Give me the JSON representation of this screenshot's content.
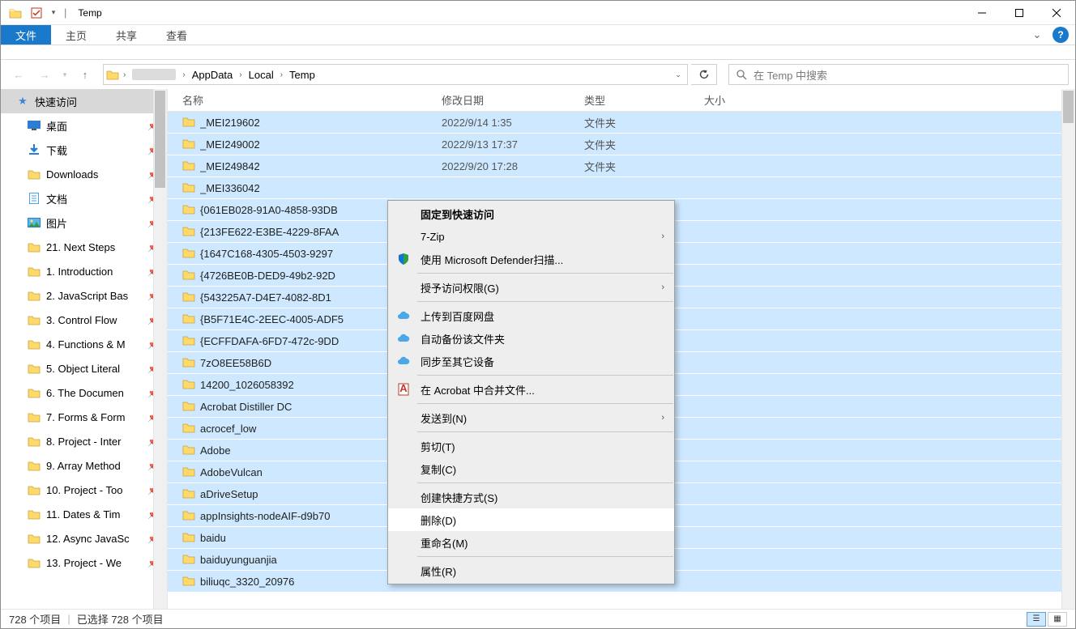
{
  "window": {
    "title": "Temp"
  },
  "ribbon": {
    "file": "文件",
    "home": "主页",
    "share": "共享",
    "view": "查看"
  },
  "address": {
    "segs": [
      "AppData",
      "Local",
      "Temp"
    ]
  },
  "search": {
    "placeholder": "在 Temp 中搜索"
  },
  "sidebar": {
    "quick": "快速访问",
    "items": [
      {
        "label": "桌面",
        "icon": "desktop"
      },
      {
        "label": "下载",
        "icon": "download"
      },
      {
        "label": "Downloads",
        "icon": "folder"
      },
      {
        "label": "文档",
        "icon": "document"
      },
      {
        "label": "图片",
        "icon": "picture"
      },
      {
        "label": "21. Next Steps",
        "icon": "folder"
      },
      {
        "label": "1. Introduction",
        "icon": "folder"
      },
      {
        "label": "2. JavaScript Bas",
        "icon": "folder"
      },
      {
        "label": "3. Control Flow",
        "icon": "folder"
      },
      {
        "label": "4. Functions & M",
        "icon": "folder"
      },
      {
        "label": "5. Object Literal",
        "icon": "folder"
      },
      {
        "label": "6. The Documen",
        "icon": "folder"
      },
      {
        "label": "7. Forms & Form",
        "icon": "folder"
      },
      {
        "label": "8. Project - Inter",
        "icon": "folder"
      },
      {
        "label": "9. Array Method",
        "icon": "folder"
      },
      {
        "label": "10. Project - Too",
        "icon": "folder"
      },
      {
        "label": "11. Dates & Tim",
        "icon": "folder"
      },
      {
        "label": "12. Async JavaSc",
        "icon": "folder"
      },
      {
        "label": "13. Project - We",
        "icon": "folder"
      }
    ]
  },
  "columns": {
    "name": "名称",
    "date": "修改日期",
    "type": "类型",
    "size": "大小"
  },
  "files": [
    {
      "name": "_MEI219602",
      "date": "2022/9/14 1:35",
      "type": "文件夹"
    },
    {
      "name": "_MEI249002",
      "date": "2022/9/13 17:37",
      "type": "文件夹"
    },
    {
      "name": "_MEI249842",
      "date": "2022/9/20 17:28",
      "type": "文件夹"
    },
    {
      "name": "_MEI336042",
      "date": "",
      "type": ""
    },
    {
      "name": "{061EB028-91A0-4858-93DB",
      "date": "",
      "type": ""
    },
    {
      "name": "{213FE622-E3BE-4229-8FAA",
      "date": "",
      "type": ""
    },
    {
      "name": "{1647C168-4305-4503-9297",
      "date": "",
      "type": ""
    },
    {
      "name": "{4726BE0B-DED9-49b2-92D",
      "date": "",
      "type": ""
    },
    {
      "name": "{543225A7-D4E7-4082-8D1",
      "date": "",
      "type": ""
    },
    {
      "name": "{B5F71E4C-2EEC-4005-ADF5",
      "date": "",
      "type": ""
    },
    {
      "name": "{ECFFDAFA-6FD7-472c-9DD",
      "date": "",
      "type": ""
    },
    {
      "name": "7zO8EE58B6D",
      "date": "",
      "type": ""
    },
    {
      "name": "14200_1026058392",
      "date": "",
      "type": ""
    },
    {
      "name": "Acrobat Distiller DC",
      "date": "",
      "type": ""
    },
    {
      "name": "acrocef_low",
      "date": "",
      "type": ""
    },
    {
      "name": "Adobe",
      "date": "",
      "type": ""
    },
    {
      "name": "AdobeVulcan",
      "date": "",
      "type": ""
    },
    {
      "name": "aDriveSetup",
      "date": "",
      "type": ""
    },
    {
      "name": "appInsights-nodeAIF-d9b70",
      "date": "",
      "type": ""
    },
    {
      "name": "baidu",
      "date": "",
      "type": ""
    },
    {
      "name": "baiduyunguanjia",
      "date": "",
      "type": ""
    },
    {
      "name": "biliuqc_3320_20976",
      "date": "",
      "type": ""
    }
  ],
  "context": {
    "pin": "固定到快速访问",
    "sevenzip": "7-Zip",
    "defender": "使用 Microsoft Defender扫描...",
    "grant": "授予访问权限(G)",
    "baidu_upload": "上传到百度网盘",
    "baidu_backup": "自动备份该文件夹",
    "baidu_sync": "同步至其它设备",
    "acrobat": "在 Acrobat 中合并文件...",
    "sendto": "发送到(N)",
    "cut": "剪切(T)",
    "copy": "复制(C)",
    "shortcut": "创建快捷方式(S)",
    "delete": "删除(D)",
    "rename": "重命名(M)",
    "properties": "属性(R)"
  },
  "status": {
    "total": "728 个项目",
    "selected": "已选择 728 个项目"
  }
}
